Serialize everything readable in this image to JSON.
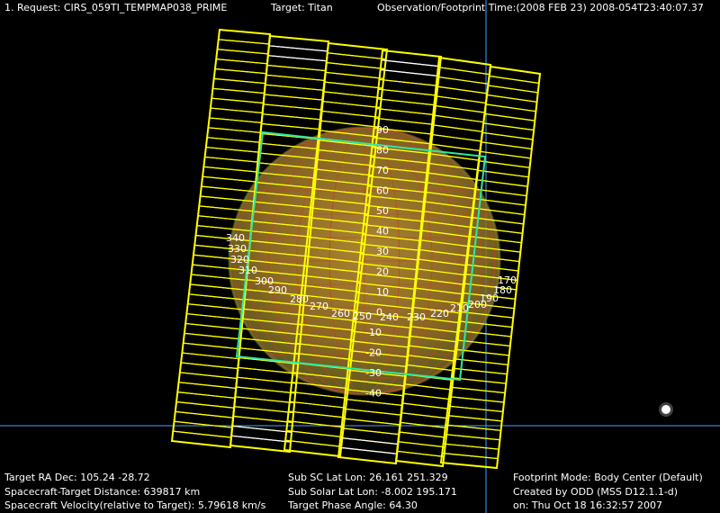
{
  "header": {
    "request": "1. Request: CIRS_059TI_TEMPMAP038_PRIME",
    "target": "Target: Titan",
    "observation_time": "Observation/Footprint Time:(2008 FEB 23) 2008-054T23:40:07.37"
  },
  "footer": {
    "left": [
      "Target RA Dec: 105.24   -28.72",
      "Spacecraft-Target Distance:  639817 km",
      "Spacecraft Velocity(relative to Target): 5.79618 km/s"
    ],
    "middle": [
      "Sub SC Lat Lon: 26.161   251.329",
      "Sub Solar Lat Lon: -8.002   195.171",
      "Target Phase Angle: 64.30"
    ],
    "right": [
      "Footprint Mode: Body Center (Default)",
      "Created by ODD (MSS D12.1.1-d)",
      "on: Thu Oct 18 16:32:57 2007"
    ]
  },
  "latitude_labels": [
    "90",
    "80",
    "70",
    "60",
    "50",
    "40",
    "30",
    "20",
    "10",
    "0",
    "-10",
    "-20",
    "-30",
    "-40"
  ],
  "longitude_labels": [
    "340",
    "330",
    "320",
    "310",
    "300",
    "290",
    "280",
    "270",
    "260",
    "250",
    "240",
    "230",
    "220",
    "210",
    "200",
    "190",
    "180",
    "170"
  ],
  "colors": {
    "background": "#000000",
    "footprint": "#ffff00",
    "footprint_outline": "#ffffff",
    "target_body": "#a08a2a",
    "fov_frame": "#2ee8a0",
    "crosshair": "#4aa0ff",
    "text": "#ffffff"
  }
}
